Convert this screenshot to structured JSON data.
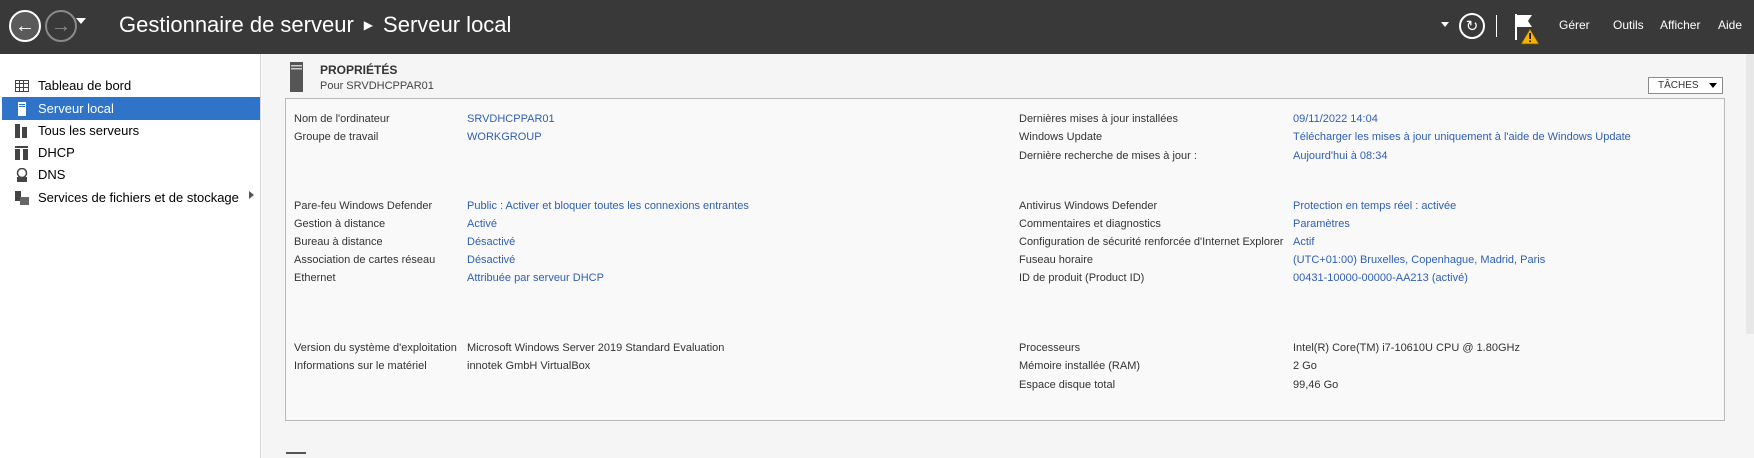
{
  "titlebar": {
    "breadcrumb_root": "Gestionnaire de serveur",
    "breadcrumb_current": "Serveur local",
    "menu": [
      "Gérer",
      "Outils",
      "Afficher",
      "Aide"
    ]
  },
  "sidebar": {
    "items": [
      {
        "label": "Tableau de bord",
        "icon": "dashboard-grid-icon"
      },
      {
        "label": "Serveur local",
        "icon": "server-icon",
        "active": true
      },
      {
        "label": "Tous les serveurs",
        "icon": "servers-icon"
      },
      {
        "label": "DHCP",
        "icon": "dhcp-icon"
      },
      {
        "label": "DNS",
        "icon": "dns-icon"
      },
      {
        "label": "Services de fichiers et de stockage",
        "icon": "storage-icon",
        "has_submenu": true
      }
    ]
  },
  "properties": {
    "title": "PROPRIÉTÉS",
    "subtitle": "Pour SRVDHCPPAR01",
    "tasks_label": "TÂCHES",
    "left": [
      {
        "label": "Nom de l'ordinateur",
        "value": "SRVDHCPPAR01",
        "link": true
      },
      {
        "label": "Groupe de travail",
        "value": "WORKGROUP",
        "link": true
      },
      {
        "label": "Pare-feu Windows Defender",
        "value": "Public : Activer et bloquer toutes les connexions entrantes",
        "link": true
      },
      {
        "label": "Gestion à distance",
        "value": "Activé",
        "link": true
      },
      {
        "label": "Bureau à distance",
        "value": "Désactivé",
        "link": true
      },
      {
        "label": "Association de cartes réseau",
        "value": "Désactivé",
        "link": true
      },
      {
        "label": "Ethernet",
        "value": "Attribuée par serveur DHCP",
        "link": true
      },
      {
        "label": "Version du système d'exploitation",
        "value": "Microsoft Windows Server 2019 Standard Evaluation",
        "link": false
      },
      {
        "label": "Informations sur le matériel",
        "value": "innotek GmbH VirtualBox",
        "link": false
      }
    ],
    "right": [
      {
        "label": "Dernières mises à jour installées",
        "value": "09/11/2022 14:04",
        "link": true
      },
      {
        "label": "Windows Update",
        "value": "Télécharger les mises à jour uniquement à l'aide de Windows Update",
        "link": true
      },
      {
        "label": "Dernière recherche de mises à jour :",
        "value": "Aujourd'hui à 08:34",
        "link": true
      },
      {
        "label": "Antivirus Windows Defender",
        "value": "Protection en temps réel : activée",
        "link": true
      },
      {
        "label": "Commentaires et diagnostics",
        "value": "Paramètres",
        "link": true
      },
      {
        "label": "Configuration de sécurité renforcée d'Internet Explorer",
        "value": "Actif",
        "link": true
      },
      {
        "label": "Fuseau horaire",
        "value": "(UTC+01:00) Bruxelles, Copenhague, Madrid, Paris",
        "link": true
      },
      {
        "label": "ID de produit (Product ID)",
        "value": "00431-10000-00000-AA213 (activé)",
        "link": true
      },
      {
        "label": "Processeurs",
        "value": "Intel(R) Core(TM) i7-10610U CPU @ 1.80GHz",
        "link": false
      },
      {
        "label": "Mémoire installée (RAM)",
        "value": "2 Go",
        "link": false
      },
      {
        "label": "Espace disque total",
        "value": "99,46 Go",
        "link": false
      }
    ]
  },
  "colors": {
    "titlebar_bg": "#393939",
    "active_item_bg": "#2f74c8",
    "link": "#2e5fb4",
    "warning": "#f5b400"
  }
}
